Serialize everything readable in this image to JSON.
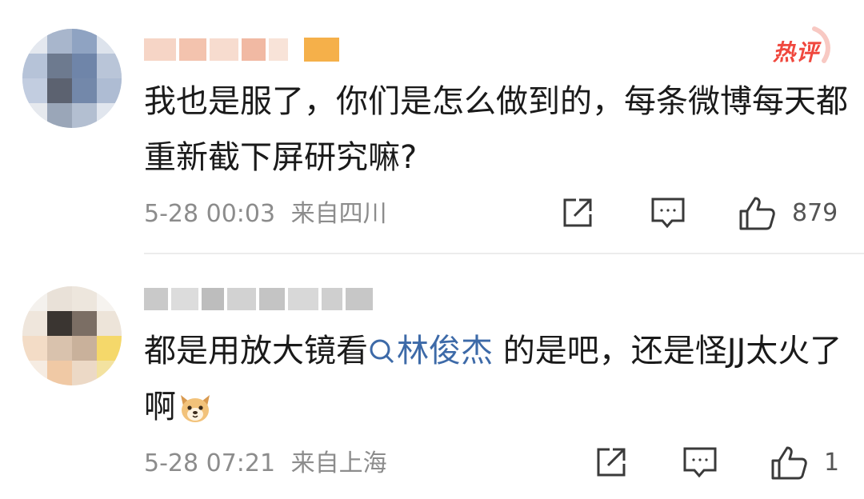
{
  "badge": {
    "hot_label": "热评"
  },
  "comments": [
    {
      "text": "我也是服了，你们是怎么做到的，每条微博每天都重新截下屏研究嘛?",
      "date": "5-28 00:03",
      "location": "来自四川",
      "likes": "879"
    },
    {
      "text_before": "都是用放大镜看",
      "topic": "林俊杰",
      "text_after": " 的是吧，还是怪JJ太火了啊",
      "emoji": "dog-face-emoji",
      "date": "5-28 07:21",
      "location": "来自上海",
      "likes": "1"
    }
  ],
  "icons": {
    "share": "share-icon",
    "reply": "comment-icon",
    "like": "thumbs-up-icon",
    "topic": "search-icon"
  },
  "colors": {
    "text": "#1a1a1a",
    "meta": "#8c8c8c",
    "link": "#3d6aa8",
    "hot_badge": "#f0483e",
    "divider": "#ececec"
  }
}
